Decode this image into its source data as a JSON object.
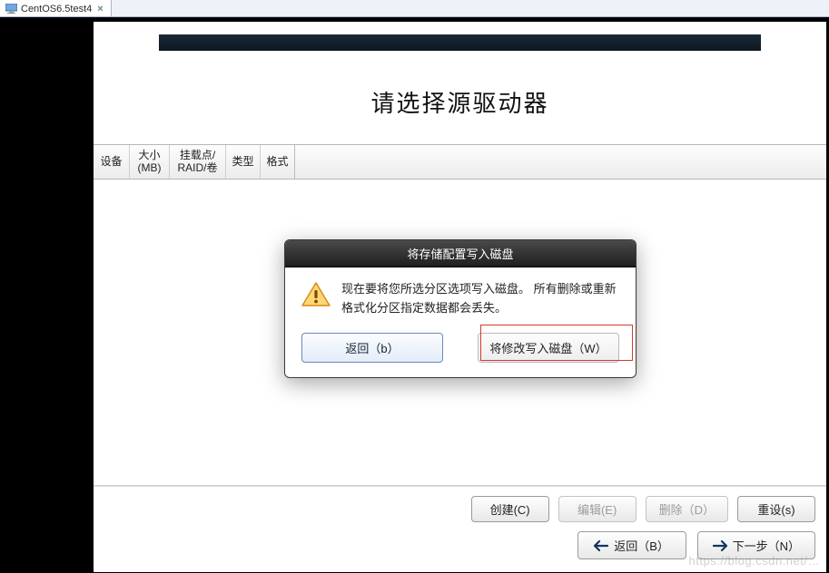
{
  "outer_tab": {
    "title": "CentOS6.5test4",
    "close_glyph": "×"
  },
  "installer": {
    "page_title": "请选择源驱动器",
    "columns": {
      "device": "设备",
      "size_l1": "大小",
      "size_l2": "(MB)",
      "mount_l1": "挂载点/",
      "mount_l2": "RAID/卷",
      "type": "类型",
      "format": "格式"
    },
    "actions": {
      "create": "创建(C)",
      "edit": "编辑(E)",
      "delete": "删除（D）",
      "reset": "重设(s)"
    },
    "nav": {
      "back": "返回（B）",
      "next": "下一步（N）"
    }
  },
  "modal": {
    "title": "将存储配置写入磁盘",
    "message": "现在要将您所选分区选项写入磁盘。 所有删除或重新格式化分区指定数据都会丢失。",
    "back_btn": "返回（b）",
    "write_btn": "将修改写入磁盘（W）"
  },
  "watermark": "https://blog.csdn.net/…"
}
